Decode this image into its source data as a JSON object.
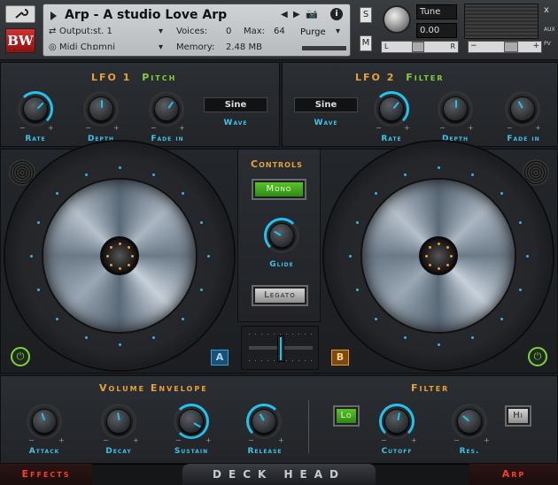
{
  "header": {
    "title": "Arp - A studio Love Arp",
    "output_label": "Output:",
    "output_value": "st. 1",
    "midi_label": "Midi Ch:",
    "midi_value": "omni",
    "voices_label": "Voices:",
    "voices_value": "0",
    "max_label": "Max:",
    "max_value": "64",
    "memory_label": "Memory:",
    "memory_value": "2.48 MB",
    "purge_label": "Purge",
    "tune_label": "Tune",
    "tune_value": "0.00",
    "solo_label": "S",
    "mute_label": "M",
    "aux_label": "AUX",
    "pv_label": "PV",
    "pan_left": "L",
    "pan_right": "R",
    "close_label": "x",
    "logo_text": "BW"
  },
  "lfo1": {
    "title_a": "LFO 1",
    "title_b": "Pitch",
    "wave_value": "Sine",
    "wave_label": "Wave",
    "knobs": [
      {
        "label": "Rate"
      },
      {
        "label": "Depth"
      },
      {
        "label": "Fade in"
      }
    ]
  },
  "lfo2": {
    "title_a": "LFO 2",
    "title_b": "Filter",
    "wave_value": "Sine",
    "wave_label": "Wave",
    "knobs": [
      {
        "label": "Rate"
      },
      {
        "label": "Depth"
      },
      {
        "label": "Fade in"
      }
    ]
  },
  "controls": {
    "title": "Controls",
    "mono_label": "Mono",
    "glide_label": "Glide",
    "legato_label": "Legato"
  },
  "decks": {
    "left_label": "A",
    "right_label": "B"
  },
  "envelope": {
    "title": "Volume Envelope",
    "knobs": [
      {
        "label": "Attack"
      },
      {
        "label": "Decay"
      },
      {
        "label": "Sustain"
      },
      {
        "label": "Release"
      }
    ]
  },
  "filter": {
    "title": "Filter",
    "lo_label": "Lo",
    "hi_label": "Hi",
    "knobs": [
      {
        "label": "Cutoff"
      },
      {
        "label": "Res."
      }
    ]
  },
  "footer": {
    "effects_label": "Effects",
    "brand": "DECK HEAD",
    "arp_label": "Arp"
  },
  "colors": {
    "accent_blue": "#22c3ee",
    "accent_orange": "#e6a23a",
    "accent_green": "#7fd13b",
    "footer_red": "#ff3c2a"
  }
}
